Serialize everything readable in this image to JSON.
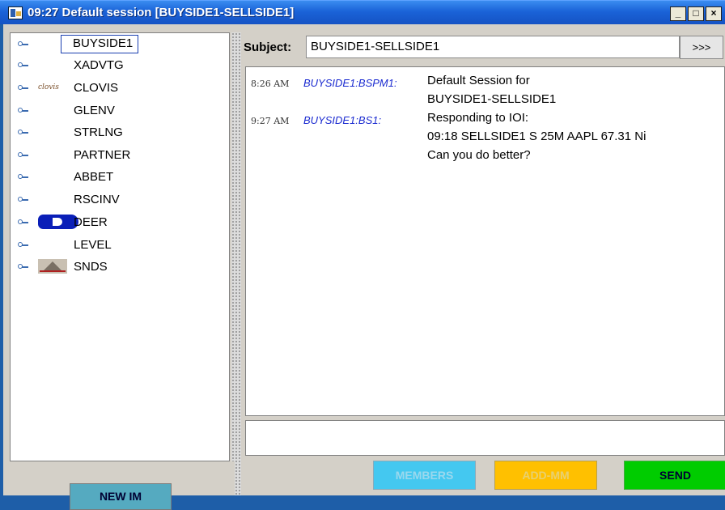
{
  "window": {
    "title": "09:27 Default session [BUYSIDE1-SELLSIDE1]",
    "controls": [
      "minimize",
      "maximize",
      "close"
    ]
  },
  "tree": {
    "items": [
      {
        "label": "BUYSIDE1",
        "selected": true,
        "logo": ""
      },
      {
        "label": "XADVTG",
        "selected": false,
        "logo": ""
      },
      {
        "label": "CLOVIS",
        "selected": false,
        "logo": "clovis"
      },
      {
        "label": "GLENV",
        "selected": false,
        "logo": ""
      },
      {
        "label": "STRLNG",
        "selected": false,
        "logo": ""
      },
      {
        "label": "PARTNER",
        "selected": false,
        "logo": ""
      },
      {
        "label": "ABBET",
        "selected": false,
        "logo": ""
      },
      {
        "label": "RSCINV",
        "selected": false,
        "logo": ""
      },
      {
        "label": "DEER",
        "selected": false,
        "logo": "deer"
      },
      {
        "label": "LEVEL",
        "selected": false,
        "logo": ""
      },
      {
        "label": "SNDS",
        "selected": false,
        "logo": "snds"
      }
    ],
    "clovis_logo_text": "clovis"
  },
  "subject": {
    "label": "Subject:",
    "value": "BUYSIDE1-SELLSIDE1",
    "more_label": ">>>"
  },
  "messages": [
    {
      "time": "8:26 AM",
      "sender": "BUYSIDE1:BSPM1:",
      "lines": [
        "Default Session for",
        "BUYSIDE1-SELLSIDE1"
      ]
    },
    {
      "time": "9:27 AM",
      "sender": "BUYSIDE1:BS1:",
      "lines": [
        "Responding to IOI:",
        "09:18 SELLSIDE1 S 25M AAPL 67.31 Ni",
        "Can you do better?"
      ]
    }
  ],
  "compose": {
    "value": ""
  },
  "buttons": {
    "new_im": "NEW IM",
    "members": "MEMBERS",
    "add_mm": "ADD-MM",
    "send": "SEND"
  },
  "colors": {
    "titlebar": "#1a63d8",
    "new_im": "#55aac0",
    "members": "#44c8f0",
    "add_mm": "#ffc000",
    "send": "#00cc00",
    "sender_text": "#1a2ad0"
  }
}
